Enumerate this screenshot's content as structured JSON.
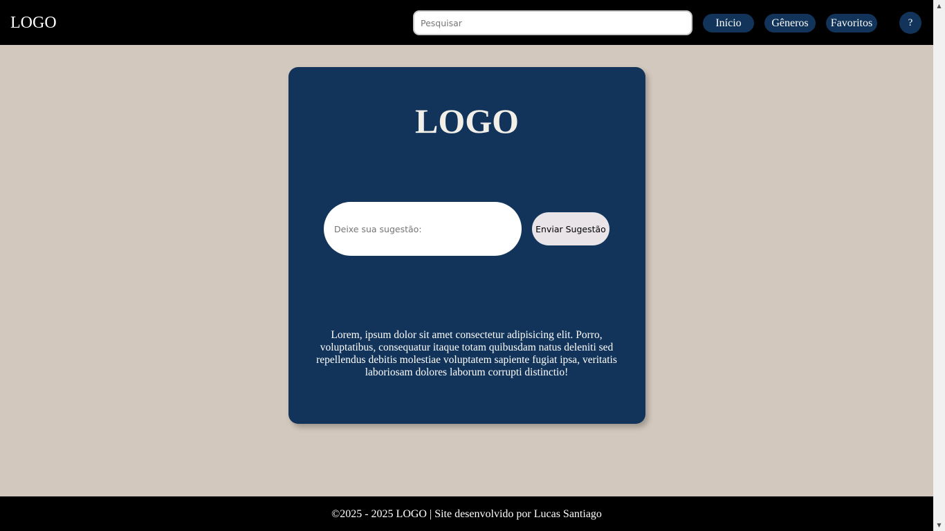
{
  "header": {
    "logo": "LOGO",
    "search_placeholder": "Pesquisar",
    "nav": {
      "inicio": "Início",
      "generos": "Gêneros",
      "favoritos": "Favoritos",
      "help": "?"
    }
  },
  "card": {
    "logo": "LOGO",
    "suggestion_placeholder": "Deixe sua sugestão:",
    "send_label": "Enviar Sugestão",
    "body_text": "Lorem, ipsum dolor sit amet consectetur adipisicing elit. Porro, voluptatibus, consequatur itaque totam quibusdam natus deleniti sed repellendus debitis molestiae voluptatem sapiente fugiat ipsa, veritatis laboriosam dolores laborum corrupti distinctio!"
  },
  "footer": {
    "text": "©2025 - 2025 LOGO | Site desenvolvido por Lucas Santiago"
  },
  "scrollbar": {
    "up_icon": "arrow-up-icon",
    "down_icon": "arrow-down-icon"
  },
  "colors": {
    "background": "#d3c8bd",
    "header": "#000000",
    "accent": "#12345a",
    "send_button": "#e8e4e7"
  }
}
